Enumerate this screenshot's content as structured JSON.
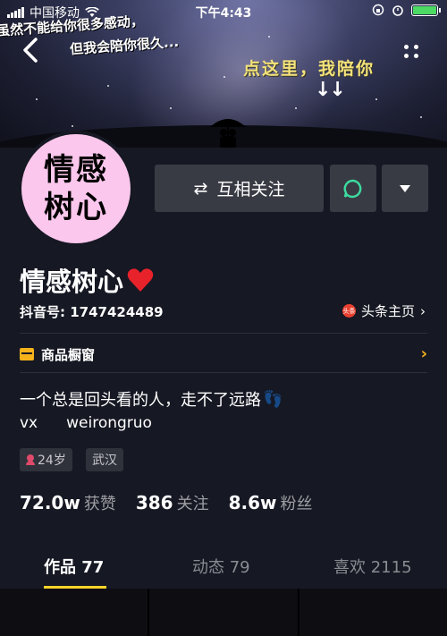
{
  "status_bar": {
    "carrier": "中国移动",
    "time": "下午4:43"
  },
  "banner": {
    "text_line1": "虽然不能给你很多感动，",
    "text_line2": "但我会陪你很久...",
    "click_hint": "点这里，我陪你",
    "arrows": "↓↓"
  },
  "profile": {
    "avatar_text": "情感树心",
    "name": "情感树心",
    "name_emoji": "❤️",
    "douyin_id": "抖音号: 1747424489",
    "toutiao_logo": "头条",
    "toutiao_link": "头条主页",
    "shop_window": "商品橱窗",
    "bio": "一个总是回头看的人，走不了远路",
    "bio_emoji": "👣",
    "vx_label": "vx",
    "vx_value": "weirongruo"
  },
  "actions": {
    "follow": "互相关注",
    "follow_icon": "⇄"
  },
  "tags": {
    "age": "24岁",
    "city": "武汉"
  },
  "stats": {
    "likes_num": "72.0w",
    "likes_label": "获赞",
    "following_num": "386",
    "following_label": "关注",
    "fans_num": "8.6w",
    "fans_label": "粉丝"
  },
  "tabs": {
    "works": "作品 77",
    "moments": "动态 79",
    "likes": "喜欢 2115"
  },
  "colors": {
    "accent": "#f9d429",
    "background": "#161823",
    "button": "#393b44",
    "avatar_bg": "#fbc7ec",
    "message_icon": "#3cdca0"
  }
}
